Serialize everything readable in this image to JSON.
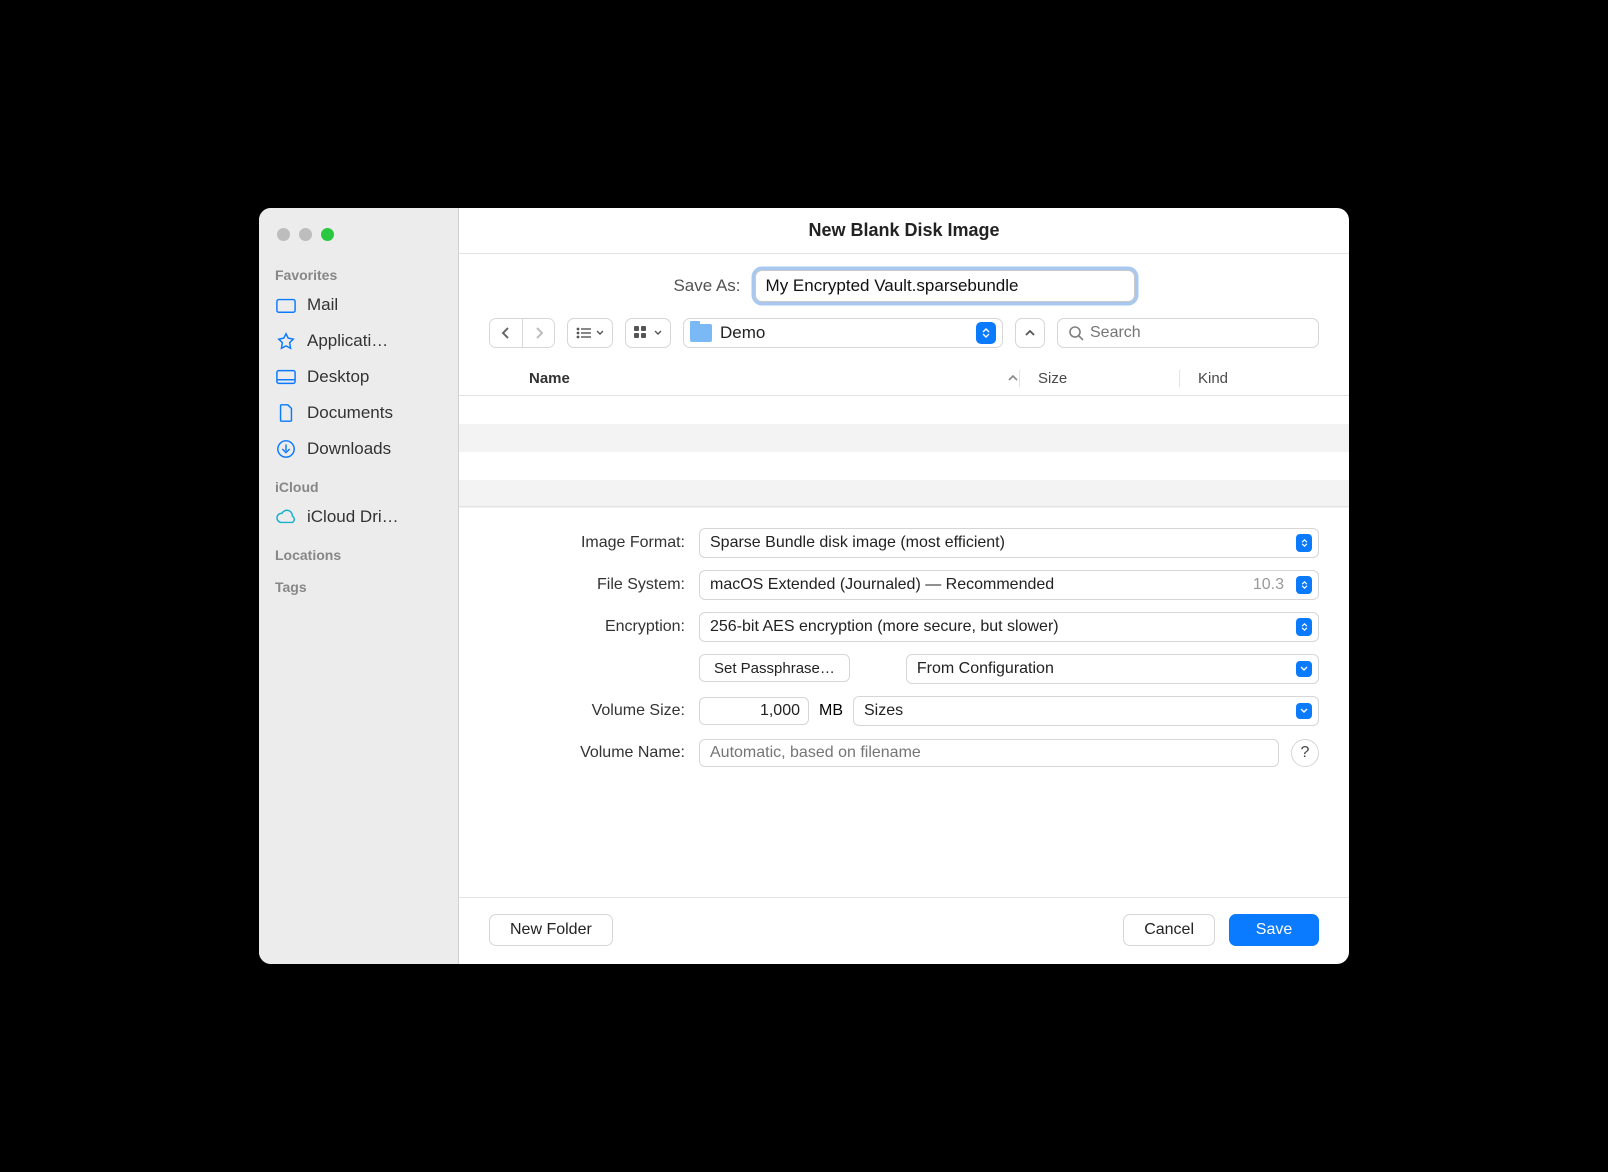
{
  "window_title": "New Blank Disk Image",
  "save_as_label": "Save As:",
  "filename": "My Encrypted Vault.sparsebundle",
  "location_folder": "Demo",
  "search_placeholder": "Search",
  "columns": {
    "name": "Name",
    "size": "Size",
    "kind": "Kind"
  },
  "sidebar": {
    "favorites_header": "Favorites",
    "favorites": [
      {
        "icon": "mail",
        "label": "Mail"
      },
      {
        "icon": "app",
        "label": "Applicati…"
      },
      {
        "icon": "desktop",
        "label": "Desktop"
      },
      {
        "icon": "doc",
        "label": "Documents"
      },
      {
        "icon": "download",
        "label": "Downloads"
      }
    ],
    "icloud_header": "iCloud",
    "icloud": [
      {
        "icon": "cloud",
        "label": "iCloud Dri…"
      }
    ],
    "locations_header": "Locations",
    "tags_header": "Tags"
  },
  "form": {
    "image_format": {
      "label": "Image Format:",
      "value": "Sparse Bundle disk image (most efficient)"
    },
    "file_system": {
      "label": "File System:",
      "value": "macOS Extended (Journaled) — Recommended",
      "aux": "10.3"
    },
    "encryption": {
      "label": "Encryption:",
      "value": "256-bit AES encryption (more secure, but slower)"
    },
    "set_passphrase": "Set Passphrase…",
    "passphrase_source": "From Configuration",
    "volume_size": {
      "label": "Volume Size:",
      "value": "1,000",
      "unit": "MB",
      "presets": "Sizes"
    },
    "volume_name": {
      "label": "Volume Name:",
      "placeholder": "Automatic, based on filename"
    }
  },
  "footer": {
    "new_folder": "New Folder",
    "cancel": "Cancel",
    "save": "Save"
  }
}
